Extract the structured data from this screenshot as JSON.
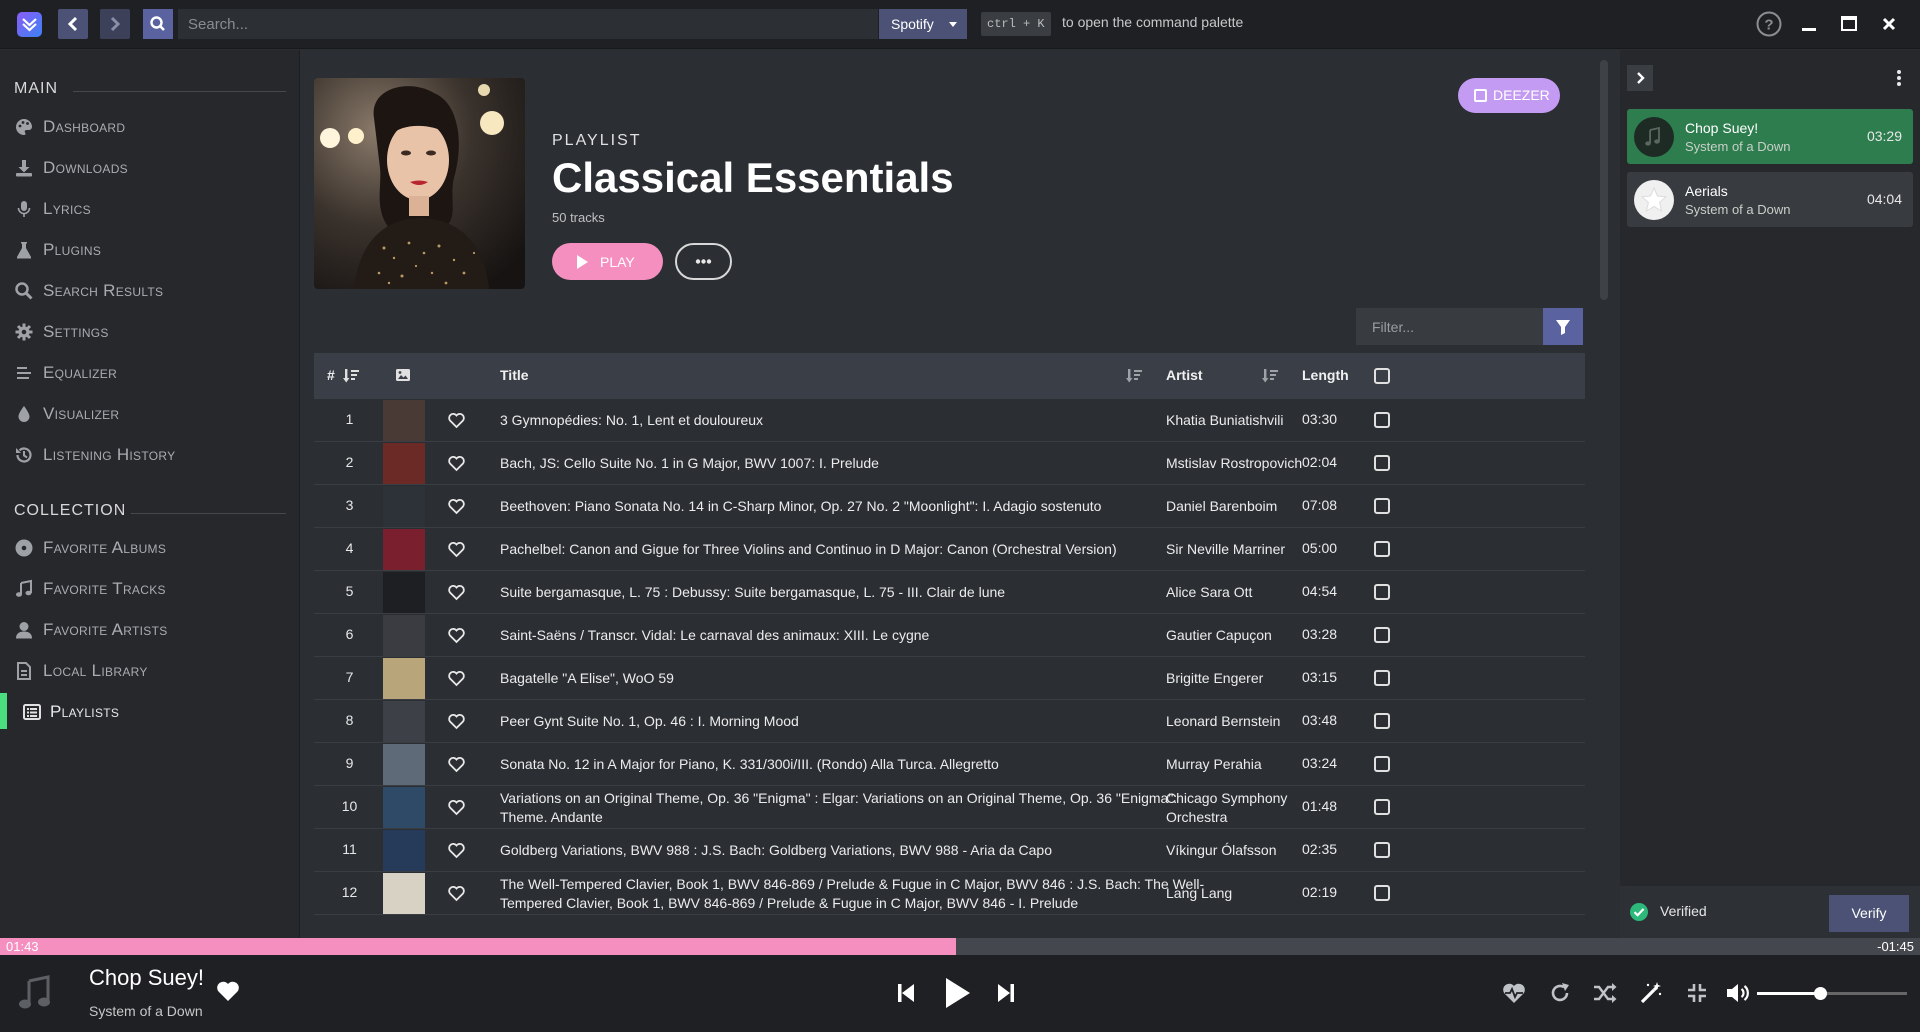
{
  "topbar": {
    "search_placeholder": "Search...",
    "provider": "Spotify",
    "shortcut": "ctrl + K",
    "shortcut_hint": "to open the command palette"
  },
  "sidebar": {
    "main_heading": "MAIN",
    "main_items": [
      {
        "label": "Dashboard",
        "icon": "palette-icon"
      },
      {
        "label": "Downloads",
        "icon": "download-icon"
      },
      {
        "label": "Lyrics",
        "icon": "microphone-icon"
      },
      {
        "label": "Plugins",
        "icon": "flask-icon"
      },
      {
        "label": "Search Results",
        "icon": "search-icon"
      },
      {
        "label": "Settings",
        "icon": "gear-icon"
      },
      {
        "label": "Equalizer",
        "icon": "sliders-icon"
      },
      {
        "label": "Visualizer",
        "icon": "droplet-icon"
      },
      {
        "label": "Listening History",
        "icon": "history-icon"
      }
    ],
    "collection_heading": "COLLECTION",
    "collection_items": [
      {
        "label": "Favorite Albums",
        "icon": "disc-icon"
      },
      {
        "label": "Favorite Tracks",
        "icon": "music-note-icon"
      },
      {
        "label": "Favorite Artists",
        "icon": "user-icon"
      },
      {
        "label": "Local Library",
        "icon": "file-icon"
      },
      {
        "label": "Playlists",
        "icon": "list-icon",
        "active": true
      }
    ]
  },
  "playlist": {
    "kind": "PLAYLIST",
    "title": "Classical Essentials",
    "track_count": "50 tracks",
    "play_label": "PLAY",
    "more_label": "•••",
    "source_label": "DEEZER",
    "filter_placeholder": "Filter..."
  },
  "table": {
    "headers": {
      "num": "#",
      "title": "Title",
      "artist": "Artist",
      "length": "Length"
    },
    "rows": [
      {
        "num": "1",
        "title": "3 Gymnopédies: No. 1, Lent et douloureux",
        "artist": "Khatia Buniatishvili",
        "length": "03:30",
        "thumb": "#4a3a36"
      },
      {
        "num": "2",
        "title": "Bach, JS: Cello Suite No. 1 in G Major, BWV 1007: I. Prelude",
        "artist": "Mstislav Rostropovich",
        "length": "02:04",
        "thumb": "#6b2a25"
      },
      {
        "num": "3",
        "title": "Beethoven: Piano Sonata No. 14 in C-Sharp Minor, Op. 27 No. 2 \"Moonlight\": I. Adagio sostenuto",
        "artist": "Daniel Barenboim",
        "length": "07:08",
        "thumb": "#2d3138"
      },
      {
        "num": "4",
        "title": "Pachelbel: Canon and Gigue for Three Violins and Continuo in D Major: Canon (Orchestral Version)",
        "artist": "Sir Neville Marriner",
        "length": "05:00",
        "thumb": "#7a1f2e"
      },
      {
        "num": "5",
        "title": "Suite bergamasque, L. 75 : Debussy: Suite bergamasque, L. 75 - III. Clair de lune",
        "artist": "Alice Sara Ott",
        "length": "04:54",
        "thumb": "#1e1f22"
      },
      {
        "num": "6",
        "title": "Saint-Saëns / Transcr. Vidal: Le carnaval des animaux: XIII. Le cygne",
        "artist": "Gautier Capuçon",
        "length": "03:28",
        "thumb": "#3a3c42"
      },
      {
        "num": "7",
        "title": "Bagatelle \"A Elise\", WoO 59",
        "artist": "Brigitte Engerer",
        "length": "03:15",
        "thumb": "#b8a67a"
      },
      {
        "num": "8",
        "title": "Peer Gynt Suite No. 1, Op. 46 : I. Morning Mood",
        "artist": "Leonard Bernstein",
        "length": "03:48",
        "thumb": "#3d4046"
      },
      {
        "num": "9",
        "title": "Sonata No. 12 in A Major for Piano, K. 331/300i/III. (Rondo) Alla Turca. Allegretto",
        "artist": "Murray Perahia",
        "length": "03:24",
        "thumb": "#5e6a78"
      },
      {
        "num": "10",
        "title": "Variations on an Original Theme, Op. 36 \"Enigma\" : Elgar: Variations on an Original Theme, Op. 36 \"Enigma\": Theme. Andante",
        "artist": "Chicago Symphony Orchestra",
        "length": "01:48",
        "thumb": "#2f4a66"
      },
      {
        "num": "11",
        "title": "Goldberg Variations, BWV 988 : J.S. Bach: Goldberg Variations, BWV 988 - Aria da Capo",
        "artist": "Víkingur Ólafsson",
        "length": "02:35",
        "thumb": "#263a5a"
      },
      {
        "num": "12",
        "title": "The Well-Tempered Clavier, Book 1, BWV 846-869 / Prelude & Fugue in C Major, BWV 846 : J.S. Bach: The Well-Tempered Clavier, Book 1, BWV 846-869 / Prelude & Fugue in C Major, BWV 846 - I. Prelude",
        "artist": "Lang Lang",
        "length": "02:19",
        "thumb": "#d8d2c4"
      }
    ]
  },
  "queue": {
    "items": [
      {
        "title": "Chop Suey!",
        "artist": "System of a Down",
        "duration": "03:29",
        "active": true
      },
      {
        "title": "Aerials",
        "artist": "System of a Down",
        "duration": "04:04",
        "active": false
      }
    ],
    "verified_label": "Verified",
    "verify_label": "Verify"
  },
  "player": {
    "elapsed": "01:43",
    "remaining": "-01:45",
    "progress": 0.498,
    "volume": 0.42,
    "title": "Chop Suey!",
    "artist": "System of a Down"
  },
  "colors": {
    "accent_pink": "#f48fc0",
    "accent_indigo": "#5a63a0",
    "active_green": "#4ade80",
    "queue_active": "#2e7d4f",
    "deezer_purple": "#c39bf2"
  }
}
